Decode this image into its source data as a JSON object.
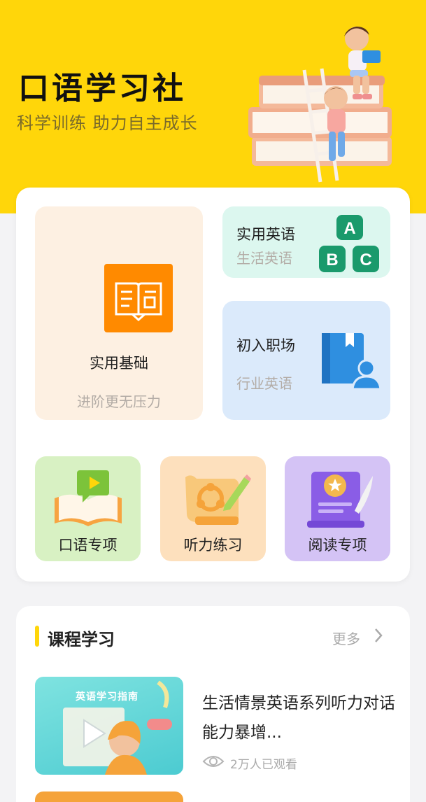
{
  "hero": {
    "title": "口语学习社",
    "subtitle": "科学训练 助力自主成长"
  },
  "modules": {
    "basic": {
      "label": "实用基础",
      "sub": "进阶更无压力"
    },
    "practical": {
      "label": "实用英语",
      "sub": "生活英语",
      "letters": [
        "A",
        "B",
        "C"
      ]
    },
    "workplace": {
      "label": "初入职场",
      "sub": "行业英语"
    },
    "oral": {
      "label": "口语专项"
    },
    "listening": {
      "label": "听力练习"
    },
    "reading": {
      "label": "阅读专项"
    }
  },
  "courses": {
    "title": "课程学习",
    "more_label": "更多",
    "items": [
      {
        "thumb_caption": "英语学习指南",
        "title": "生活情景英语系列听力对话能力暴增...",
        "views": "2万人已观看"
      }
    ]
  },
  "colors": {
    "accent_yellow": "#ffd60a",
    "practical_green": "#1a9a6c",
    "workplace_blue": "#2f8fe0",
    "basic_orange": "#ff8a00"
  },
  "icons": [
    "open-book-icon",
    "abc-blocks-icon",
    "book-person-icon",
    "video-book-icon",
    "map-pencil-icon",
    "medal-document-icon",
    "chevron-right-icon",
    "eye-icon",
    "play-icon"
  ]
}
